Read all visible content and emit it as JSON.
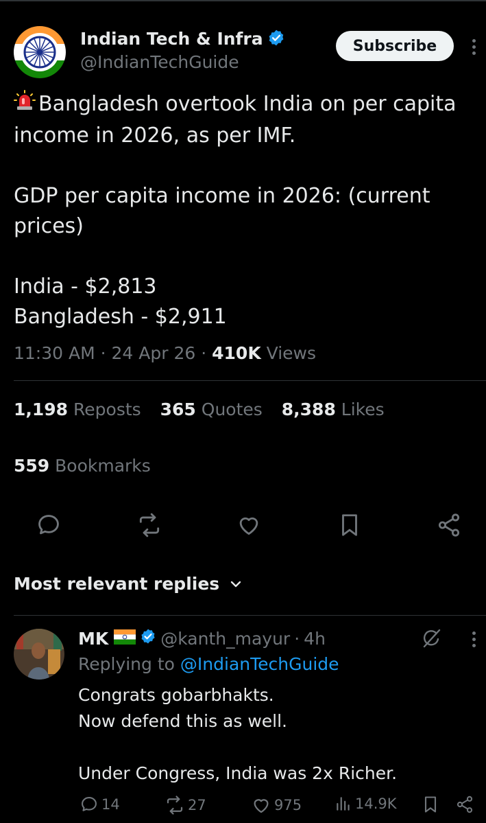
{
  "tweet": {
    "author_name": "Indian Tech & Infra",
    "handle": "@IndianTechGuide",
    "subscribe_label": "Subscribe",
    "text": "Bangladesh overtook India on per capita income in 2026, as per IMF.\n\nGDP per capita income in 2026: (current prices)\n\nIndia - $2,813\nBangladesh - $2,911",
    "time": "11:30 AM",
    "date": "24 Apr 26",
    "views_count": "410K",
    "views_label": "Views",
    "reposts_count": "1,198",
    "reposts_label": "Reposts",
    "quotes_count": "365",
    "quotes_label": "Quotes",
    "likes_count": "8,388",
    "likes_label": "Likes",
    "bookmarks_count": "559",
    "bookmarks_label": "Bookmarks"
  },
  "icons": {
    "siren": "siren-emoji-icon",
    "verified": "verified-badge-icon",
    "reply": "reply-icon",
    "repost": "repost-icon",
    "like": "heart-icon",
    "bookmark": "bookmark-icon",
    "share": "share-icon",
    "grok": "grok-icon",
    "more": "more-vertical-icon",
    "analytics": "analytics-icon"
  },
  "replies_header": {
    "label": "Most relevant replies"
  },
  "reply": {
    "name": "MK",
    "handle": "@kanth_mayur",
    "time_ago": "4h",
    "replying_prefix": "Replying to",
    "replying_to": "@IndianTechGuide",
    "text": "Congrats gobarbhakts.\nNow defend this as well.\n\nUnder Congress, India was 2x Richer.",
    "replies_count": "14",
    "reposts_count": "27",
    "likes_count": "975",
    "views_count": "14.9K"
  },
  "colors": {
    "background": "#000000",
    "text_primary": "#e7e9ea",
    "text_secondary": "#71767b",
    "link": "#1d9bf0",
    "divider": "#2f3336",
    "button_bg": "#eff3f4"
  }
}
